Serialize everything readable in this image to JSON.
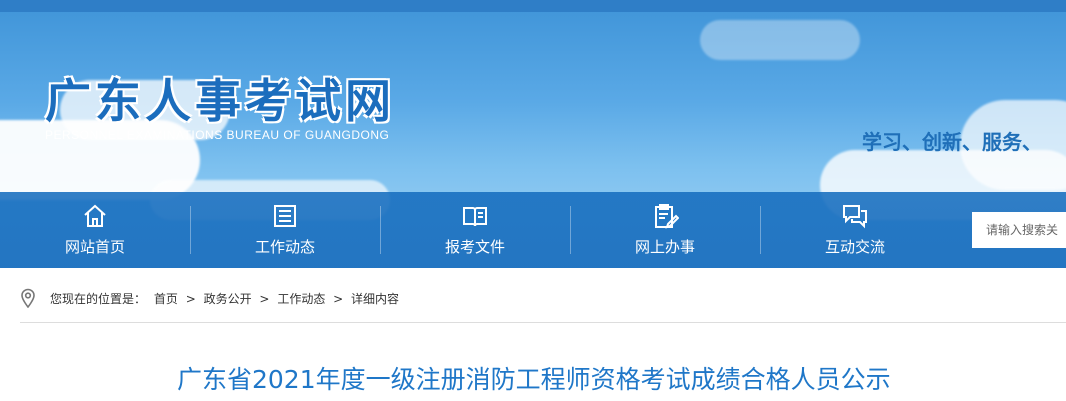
{
  "header": {
    "site_name": "广东人事考试网",
    "site_name_en": "PERSONNEL EXAMINATIONS BUREAU OF GUANGDONG",
    "slogan": "学习、创新、服务、"
  },
  "nav": {
    "items": [
      {
        "label": "网站首页",
        "icon": "home-icon"
      },
      {
        "label": "工作动态",
        "icon": "news-list-icon"
      },
      {
        "label": "报考文件",
        "icon": "open-book-icon"
      },
      {
        "label": "网上办事",
        "icon": "clipboard-edit-icon"
      },
      {
        "label": "互动交流",
        "icon": "chat-bubbles-icon"
      }
    ],
    "search_placeholder": "请输入搜索关"
  },
  "breadcrumb": {
    "prefix": "您现在的位置是：",
    "items": [
      "首页",
      "政务公开",
      "工作动态",
      "详细内容"
    ],
    "separator": ">"
  },
  "article": {
    "title": "广东省2021年度一级注册消防工程师资格考试成绩合格人员公示"
  },
  "colors": {
    "nav_bg": "#176ebf",
    "title_blue": "#1f77c8",
    "logo_blue": "#1b6dbd"
  }
}
